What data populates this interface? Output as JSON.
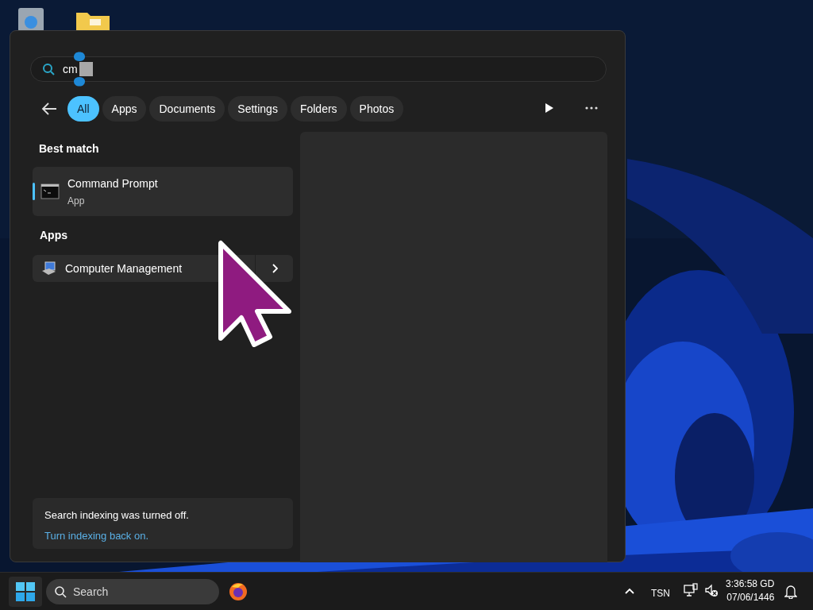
{
  "search": {
    "value": "cm"
  },
  "filters": [
    {
      "label": "All",
      "selected": true
    },
    {
      "label": "Apps",
      "selected": false
    },
    {
      "label": "Documents",
      "selected": false
    },
    {
      "label": "Settings",
      "selected": false
    },
    {
      "label": "Folders",
      "selected": false
    },
    {
      "label": "Photos",
      "selected": false
    }
  ],
  "best_match": {
    "heading": "Best match",
    "items": [
      {
        "title": "Command Prompt",
        "subtitle": "App",
        "selected": true
      }
    ]
  },
  "apps": {
    "heading": "Apps",
    "items": [
      {
        "title": "Computer Management"
      }
    ]
  },
  "notice": {
    "text": "Search indexing was turned off.",
    "link": "Turn indexing back on."
  },
  "taskbar": {
    "search_placeholder": "Search"
  },
  "tray": {
    "language": "TSN",
    "time": "3:36:58 GD",
    "date": "07/06/1446"
  }
}
